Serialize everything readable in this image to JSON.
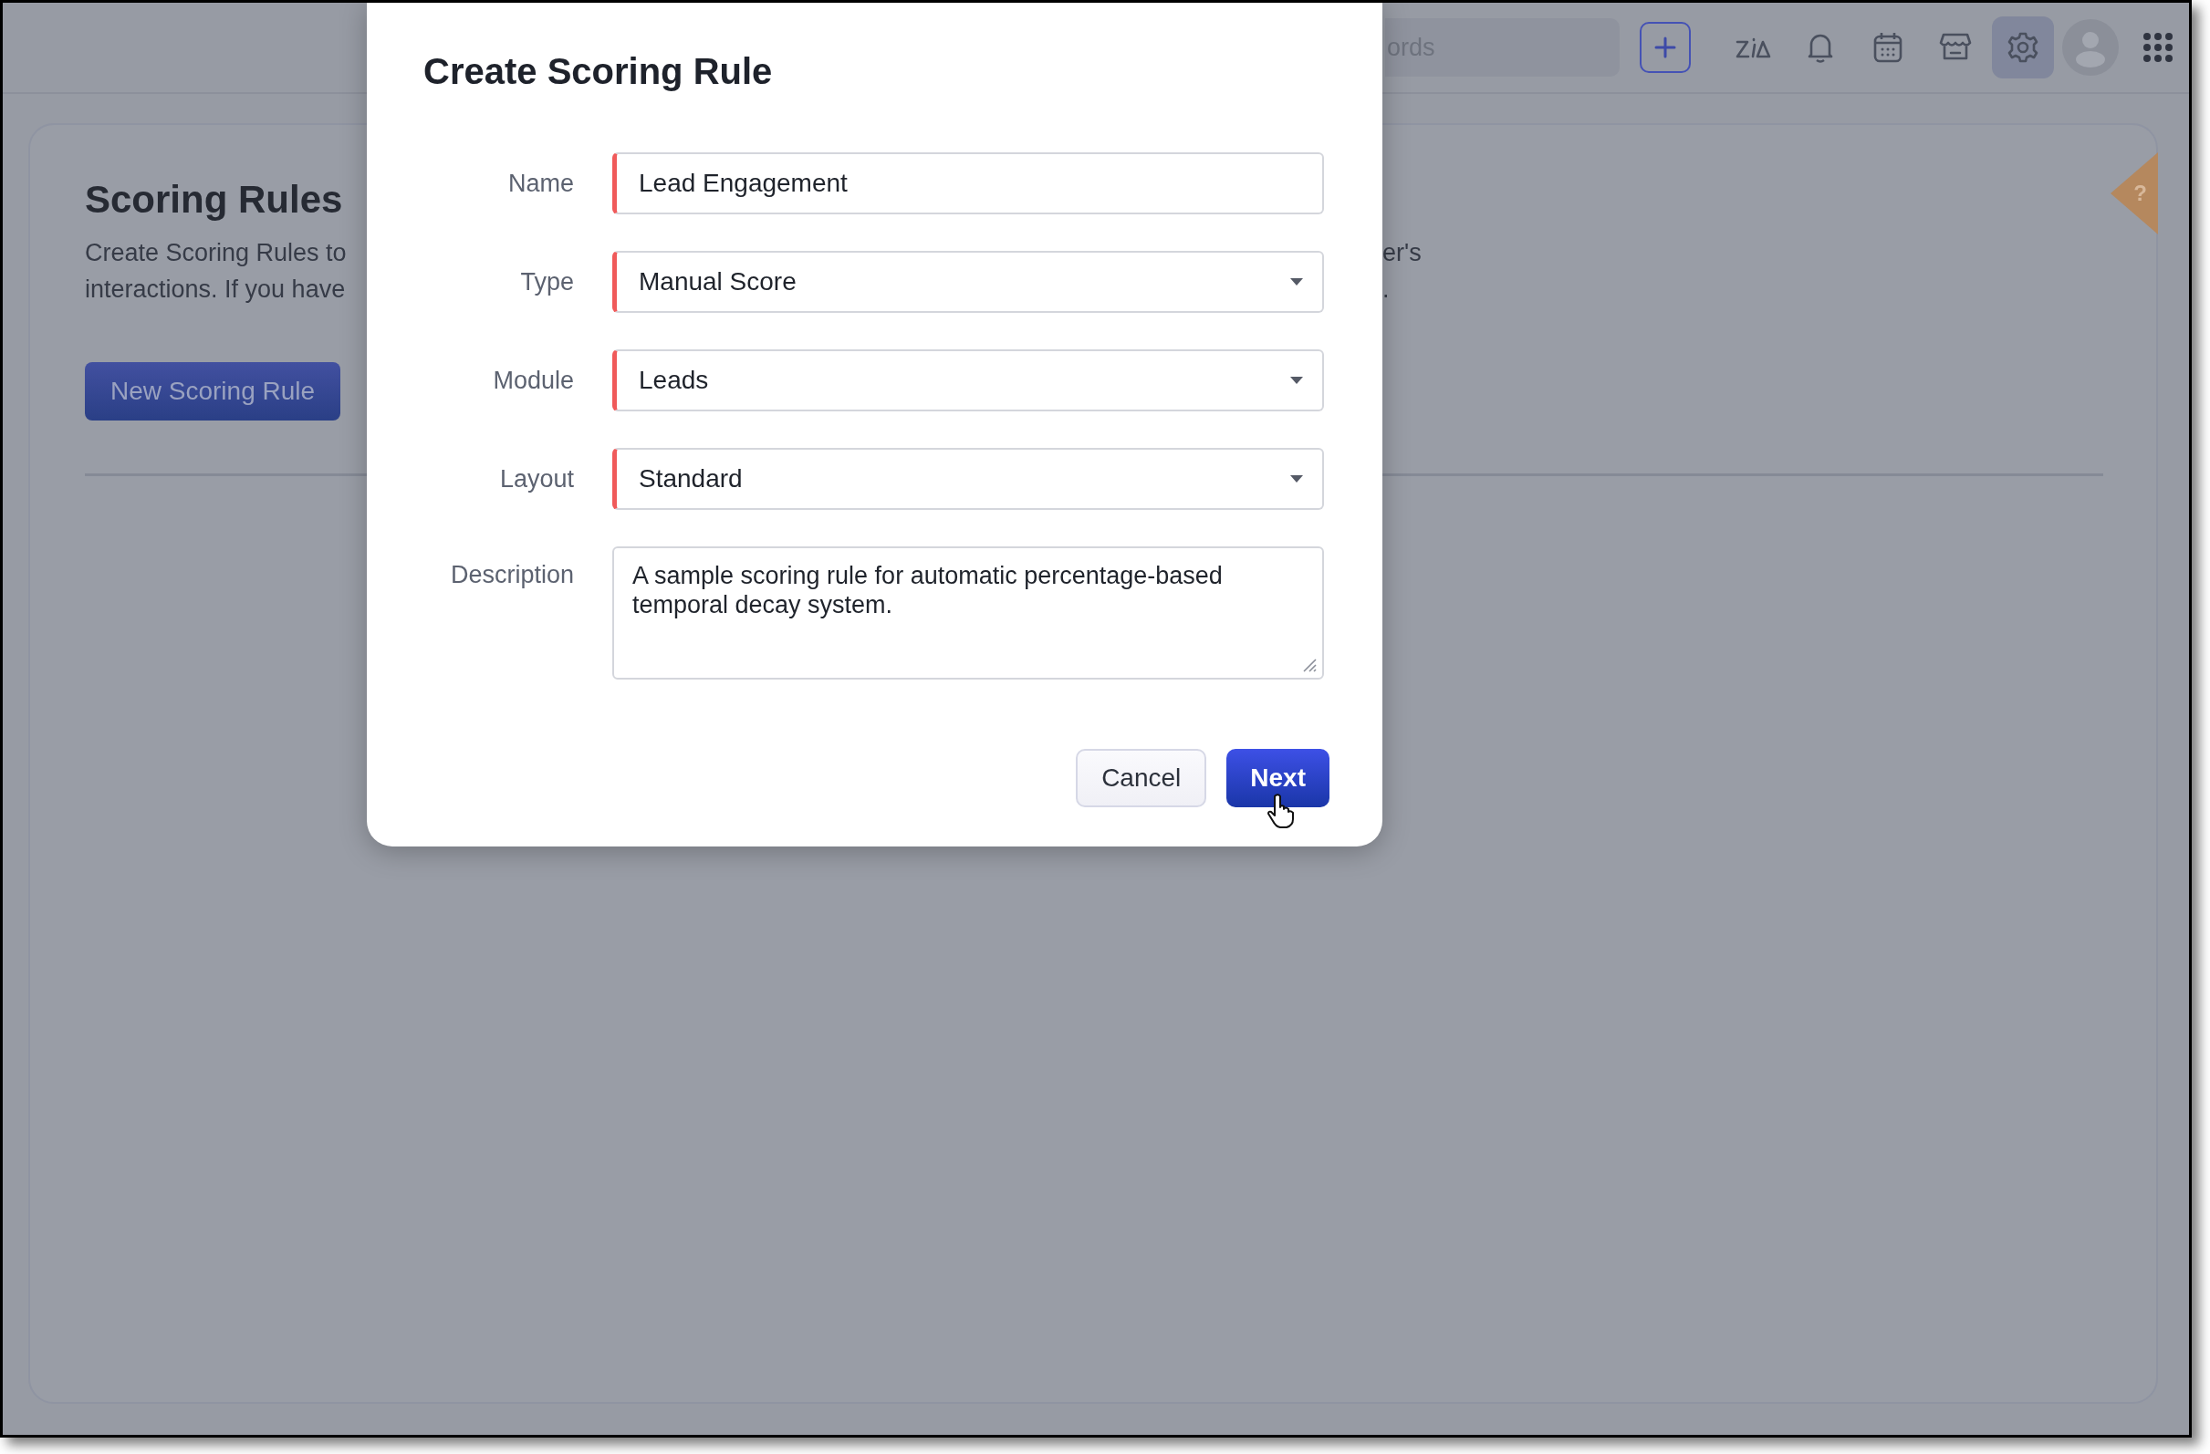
{
  "topbar": {
    "search": {
      "placeholder": "ords"
    },
    "tools": [
      {
        "kind": "add",
        "selected": false
      },
      {
        "kind": "zia",
        "selected": false
      },
      {
        "kind": "bell",
        "selected": false
      },
      {
        "kind": "calendar",
        "selected": false
      },
      {
        "kind": "store",
        "selected": false
      },
      {
        "kind": "settings",
        "selected": true
      },
      {
        "kind": "avatar",
        "selected": false
      },
      {
        "kind": "apps",
        "selected": false
      }
    ]
  },
  "page": {
    "title": "Scoring Rules",
    "description_left": [
      "Create Scoring Rules to",
      "interactions. If you have"
    ],
    "description_right": [
      "er's",
      "."
    ],
    "new_button": "New Scoring Rule",
    "help_tab": "?"
  },
  "dialog": {
    "title": "Create Scoring Rule",
    "fields": [
      {
        "label": "Name",
        "kind": "text",
        "value": "Lead Engagement",
        "required": true
      },
      {
        "label": "Type",
        "kind": "select",
        "value": "Manual Score",
        "required": true
      },
      {
        "label": "Module",
        "kind": "select",
        "value": "Leads",
        "required": true
      },
      {
        "label": "Layout",
        "kind": "select",
        "value": "Standard",
        "required": true
      },
      {
        "label": "Description",
        "kind": "textarea",
        "value": "A sample scoring rule for automatic percentage-based temporal decay system.",
        "required": false
      }
    ],
    "buttons": [
      {
        "label": "Cancel",
        "kind": "secondary",
        "hovered": false
      },
      {
        "label": "Next",
        "kind": "primary",
        "hovered": true
      }
    ]
  }
}
